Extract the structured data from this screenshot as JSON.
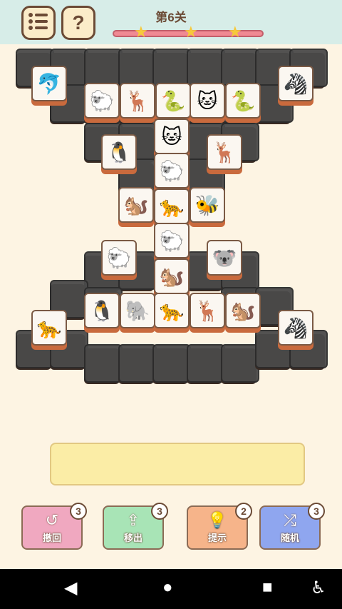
{
  "header": {
    "level_title": "第6关",
    "stars": 3
  },
  "tray": {
    "slots_filled": 0
  },
  "tools": [
    {
      "label": "撤回",
      "count": "3",
      "icon": "undo-icon",
      "color": "#f0a8c0"
    },
    {
      "label": "移出",
      "count": "3",
      "icon": "move-out-icon",
      "color": "#a8e4b6"
    },
    {
      "label": "提示",
      "count": "2",
      "icon": "hint-bulb-icon",
      "color": "#f6b48a"
    },
    {
      "label": "随机",
      "count": "3",
      "icon": "shuffle-icon",
      "color": "#8fa6ef"
    }
  ],
  "tiles": {
    "top_row": [
      "🐬",
      "🐑",
      "🦌",
      "🐍",
      "🐱",
      "🐍",
      "🦓"
    ],
    "mid_1": [
      "🐱"
    ],
    "mid_2": [
      "🐧",
      "🐑",
      "🦌"
    ],
    "mid_3": [
      "🐿️",
      "🐆",
      "🐝"
    ],
    "mid_4": [
      "🐑",
      "🐑",
      "🐨"
    ],
    "mid_5": [
      "🐿️"
    ],
    "bottom_row": [
      "🐆",
      "🐧",
      "🐘",
      "🐆",
      "🦌",
      "🐿️",
      "🦓"
    ]
  },
  "colors": {
    "accent": "#6b4a35",
    "tray": "#fbeda6",
    "background": "#fdf4e3"
  }
}
